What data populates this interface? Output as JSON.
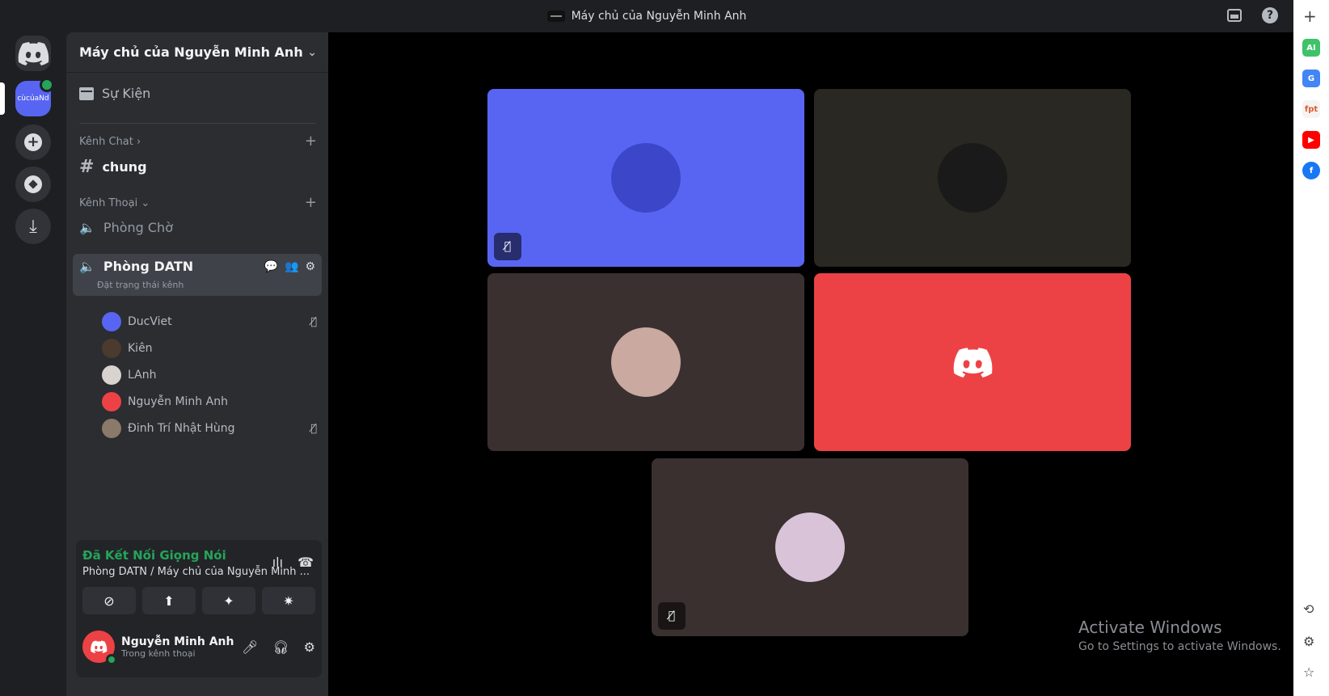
{
  "titlebar": {
    "title": "Máy chủ của Nguyễn Minh Anh"
  },
  "rail": {
    "server_label": "cùcủaNd"
  },
  "guild": {
    "name": "Máy chủ của Nguyễn Minh Anh",
    "events_label": "Sự Kiện",
    "text_category": "Kênh Chat",
    "text_channels": [
      "chung"
    ],
    "voice_category": "Kênh Thoại",
    "voice_channels": [
      "Phòng Chờ",
      "Phòng DATN"
    ],
    "active_channel": {
      "name": "Phòng DATN",
      "status": "Đặt trạng thái kênh"
    },
    "voice_users": [
      {
        "name": "DucViet",
        "muted": true
      },
      {
        "name": "Kiên",
        "muted": false
      },
      {
        "name": "LAnh",
        "muted": false
      },
      {
        "name": "Nguyễn Minh Anh",
        "muted": false
      },
      {
        "name": "Đinh Trí Nhật Hùng",
        "muted": true
      }
    ]
  },
  "voice_panel": {
    "status": "Đã Kết Nối Giọng Nói",
    "location": "Phòng DATN / Máy chủ của Nguyễn Minh ..."
  },
  "user": {
    "name": "Nguyễn Minh Anh",
    "status": "Trong kênh thoại"
  },
  "watermark": {
    "title": "Activate Windows",
    "subtitle": "Go to Settings to activate Windows."
  },
  "colors": {
    "blurple": "#5865f2",
    "green": "#23a55a",
    "red": "#ed4245"
  }
}
